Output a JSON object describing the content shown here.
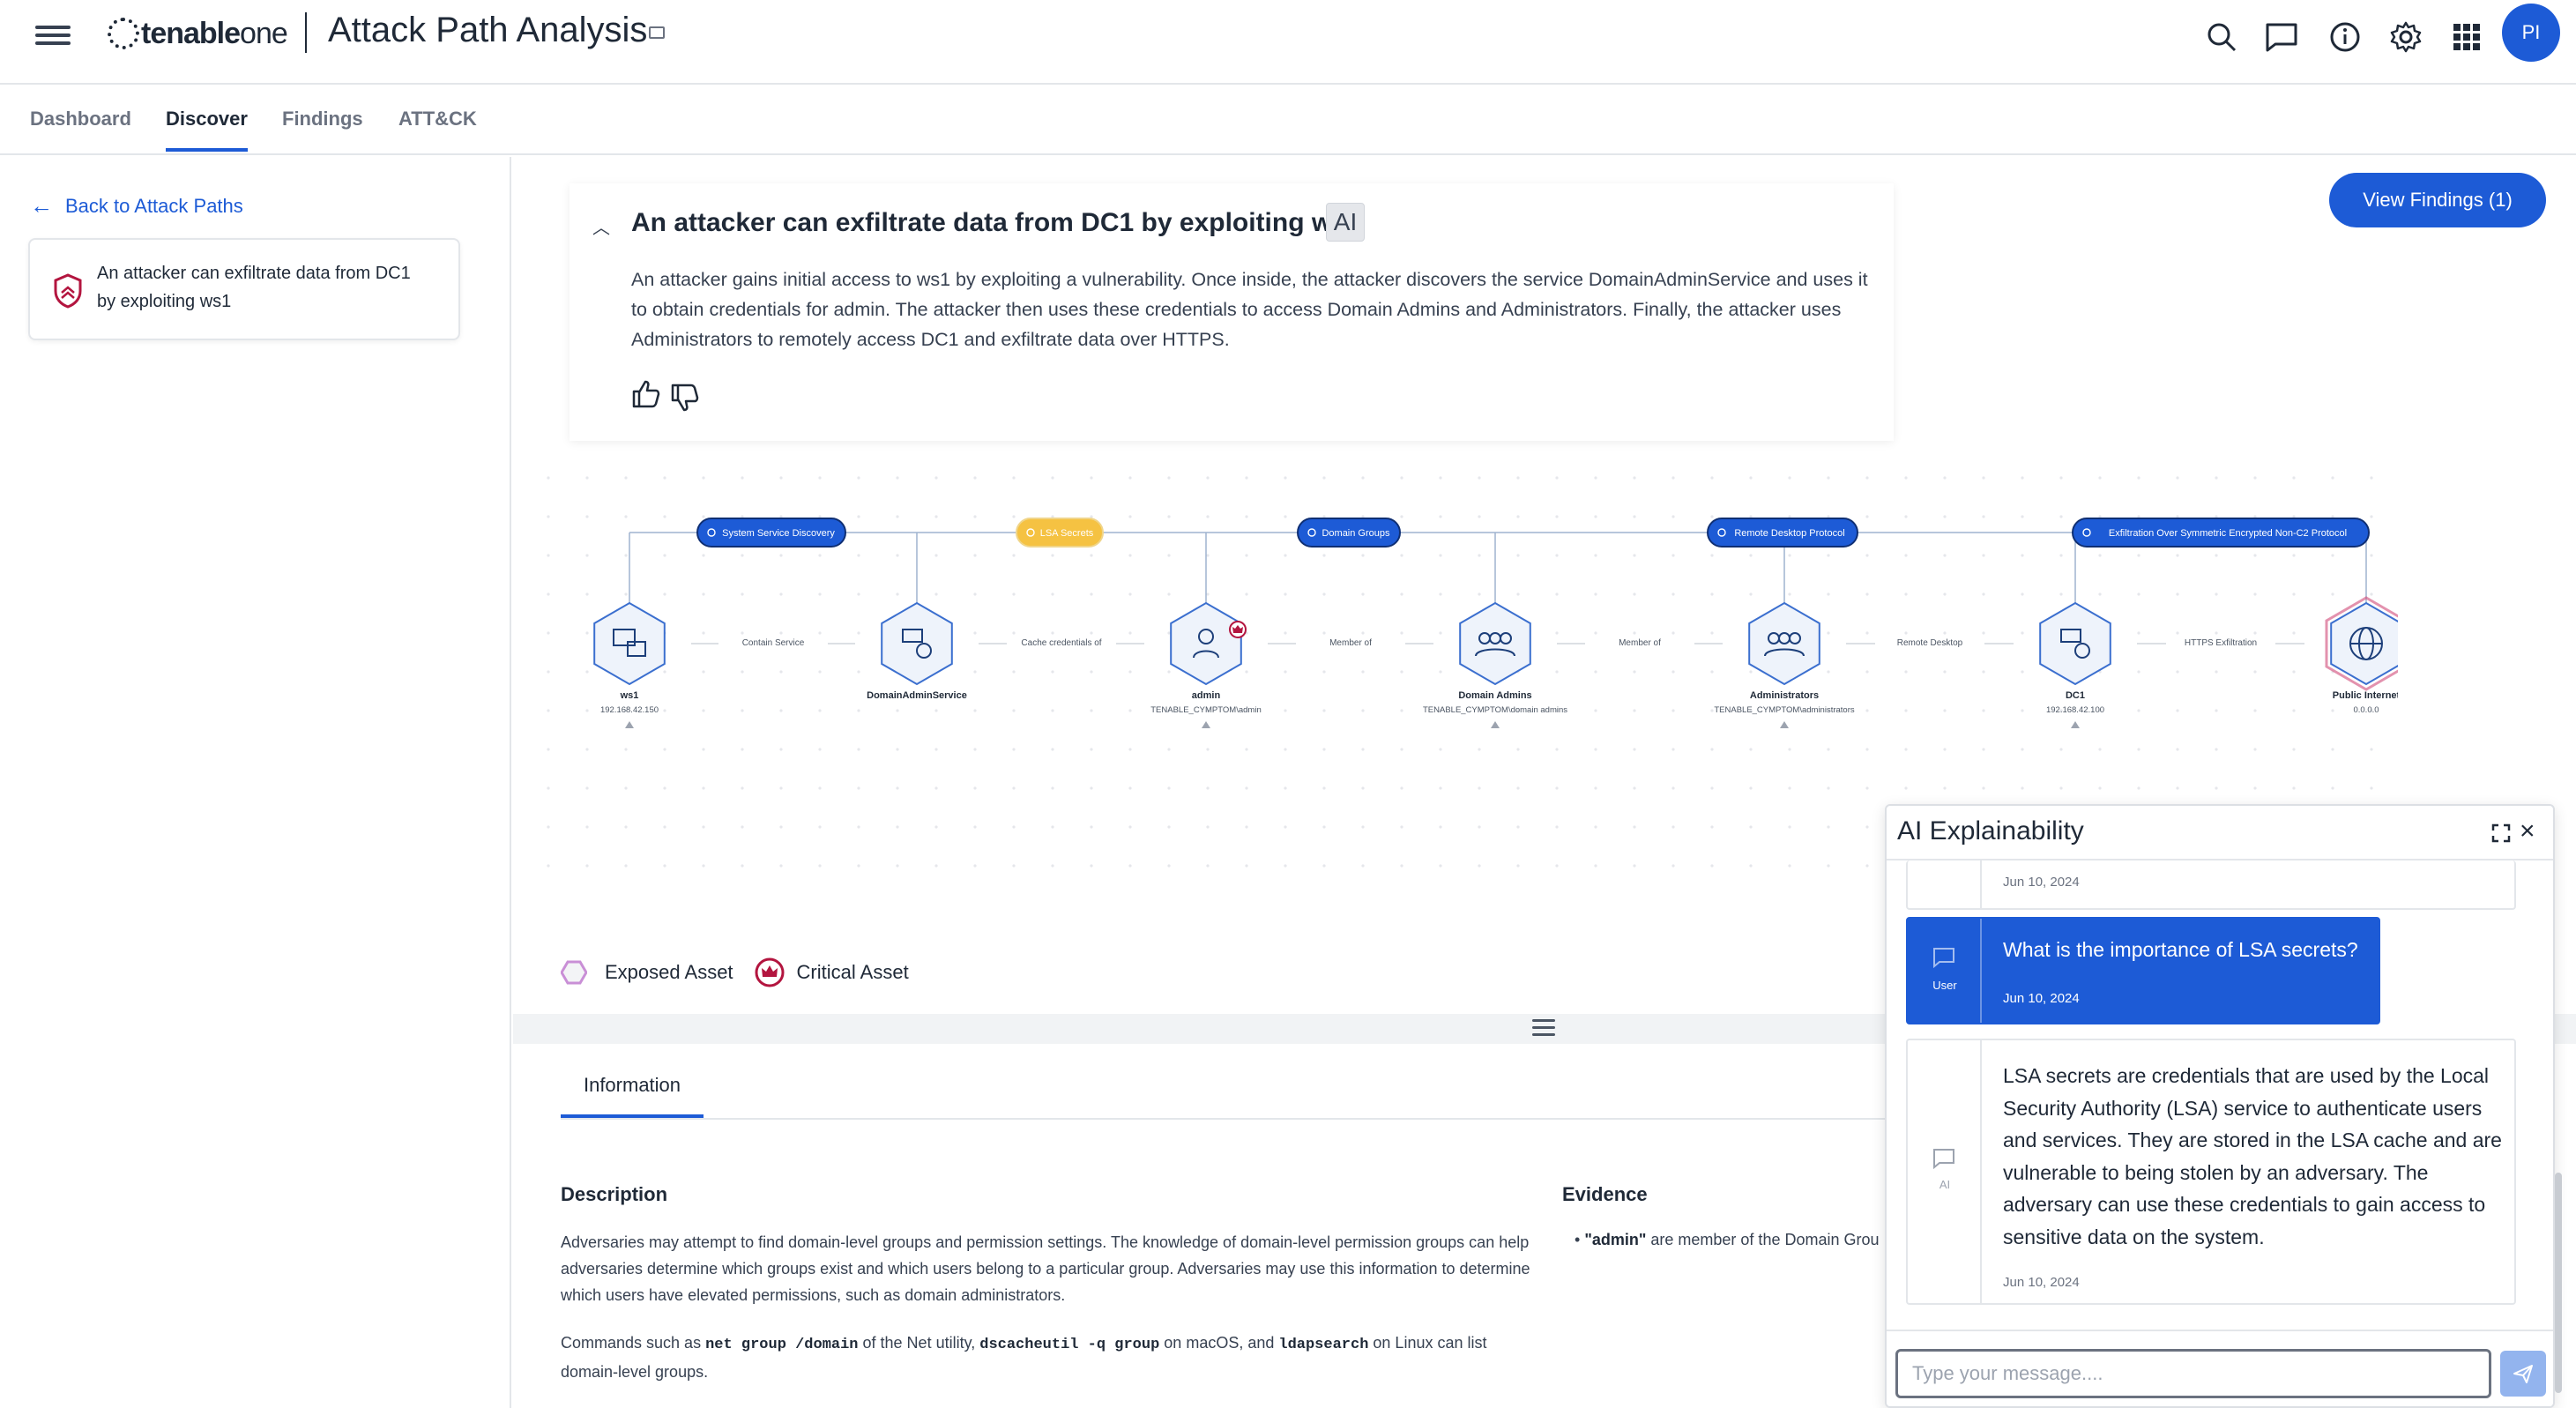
{
  "topbar": {
    "logo_brand": "tenable",
    "logo_product": "one",
    "app_title": "Attack Path Analysis",
    "user_initials": "PI",
    "icons": [
      "search-icon",
      "chat-icon",
      "info-icon",
      "gear-icon",
      "apps-grid-icon"
    ]
  },
  "nav": {
    "tabs": [
      {
        "label": "Dashboard",
        "active": false
      },
      {
        "label": "Discover",
        "active": true
      },
      {
        "label": "Findings",
        "active": false
      },
      {
        "label": "ATT&CK",
        "active": false
      }
    ]
  },
  "sidebar": {
    "back_label": "Back to Attack Paths",
    "path_card_line1": "An attacker can exfiltrate data from DC1",
    "path_card_line2": "by exploiting ws1"
  },
  "main": {
    "view_findings_label": "View Findings (1)",
    "ai_summary": {
      "title": "An attacker can exfiltrate data from DC1 by exploiting ws1",
      "badge": "AI",
      "description": "An attacker gains initial access to ws1 by exploiting a vulnerability. Once inside, the attacker discovers the service DomainAdminService and uses it to obtain credentials for admin. The attacker then uses these credentials to access Domain Admins and Administrators. Finally, the attacker uses Administrators to remotely access DC1 and exfiltrate data over HTTPS."
    },
    "graph": {
      "techniques": [
        "System Service Discovery",
        "LSA Secrets",
        "Domain Groups",
        "Remote Desktop Protocol",
        "Exfiltration Over Symmetric Encrypted Non-C2 Protocol"
      ],
      "edges": [
        "Contain Service",
        "Cache credentials of",
        "Member of",
        "Member of",
        "Remote Desktop",
        "HTTPS Exfiltration"
      ],
      "nodes": [
        {
          "name": "ws1",
          "sub": "192.168.42.150",
          "icon": "workstation-icon"
        },
        {
          "name": "DomainAdminService",
          "sub": "",
          "icon": "service-gear-icon"
        },
        {
          "name": "admin",
          "sub": "TENABLE_CYMPTOM\\admin",
          "icon": "user-icon"
        },
        {
          "name": "Domain Admins",
          "sub": "TENABLE_CYMPTOM\\domain admins",
          "icon": "group-icon"
        },
        {
          "name": "Administrators",
          "sub": "TENABLE_CYMPTOM\\administrators",
          "icon": "group-icon"
        },
        {
          "name": "DC1",
          "sub": "192.168.42.100",
          "icon": "server-icon"
        },
        {
          "name": "Public Internet",
          "sub": "0.0.0.0",
          "icon": "globe-icon"
        }
      ]
    },
    "legend": {
      "exposed": "Exposed Asset",
      "critical": "Critical Asset"
    },
    "details": {
      "tab_label": "Information",
      "description_heading": "Description",
      "description_p1": "Adversaries may attempt to find domain-level groups and permission settings. The knowledge of domain-level permission groups can help adversaries determine which groups exist and which users belong to a particular group. Adversaries may use this information to determine which users have elevated permissions, such as domain administrators.",
      "cmd_prefix": "Commands such as ",
      "cmd1": "net group /domain",
      "cmd_mid1": " of the Net utility, ",
      "cmd2": "dscacheutil -q group",
      "cmd_mid2": " on macOS, and ",
      "cmd3": "ldapsearch",
      "cmd_suffix": " on Linux can list domain-level groups.",
      "evidence_heading": "Evidence",
      "evidence_bold": "\"admin\"",
      "evidence_rest": " are member of the Domain Grou"
    }
  },
  "chat": {
    "title": "AI Explainability",
    "messages": [
      {
        "who": "",
        "date": "Jun 10, 2024",
        "text": ""
      },
      {
        "who": "User",
        "date": "Jun 10, 2024",
        "text": "What is the importance of LSA secrets?"
      },
      {
        "who": "AI",
        "date": "Jun 10, 2024",
        "text": "LSA secrets are credentials that are used by the Local Security Authority (LSA) service to authenticate users and services. They are stored in the LSA cache and are vulnerable to being stolen by an adversary. The adversary can use these credentials to gain access to sensitive data on the system."
      }
    ],
    "input_placeholder": "Type your message....",
    "colors": {
      "accent": "#1d5bd6",
      "send_disabled": "#93b4ee"
    }
  },
  "colors": {
    "primary": "#1d5bd6",
    "technique_highlight": "#f5c242",
    "exposed_asset": "#d14a78",
    "critical_asset": "#b3153f"
  }
}
